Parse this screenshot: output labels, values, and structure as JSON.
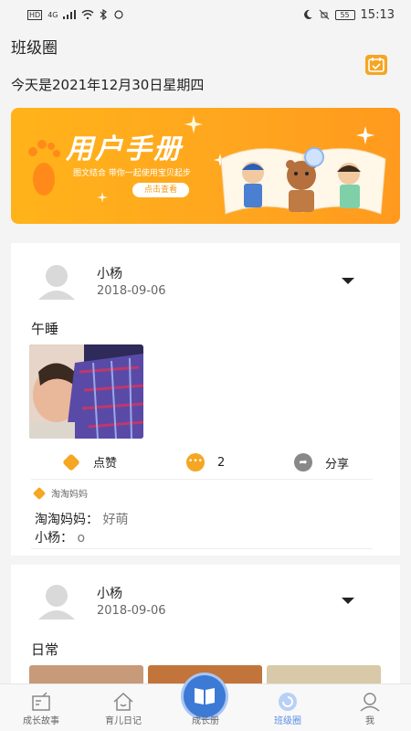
{
  "status_bar": {
    "left": [
      "HD",
      "4G",
      "signal",
      "wifi",
      "bluetooth",
      "huawei"
    ],
    "battery": "55",
    "time": "15:13"
  },
  "header": {
    "title": "班级圈",
    "date_line": "今天是2021年12月30日星期四"
  },
  "banner": {
    "title": "用户手册",
    "subtitle": "图文结合 带你一起使用宝贝起步",
    "button": "点击查看"
  },
  "posts": [
    {
      "user": "小杨",
      "date": "2018-09-06",
      "title": "午睡",
      "like_label": "点赞",
      "comment_count": "2",
      "share_label": "分享",
      "liked_by": "淘淘妈妈",
      "comments": [
        {
          "name": "淘淘妈妈：",
          "text": "好萌"
        },
        {
          "name": "小杨：",
          "text": "o"
        }
      ]
    },
    {
      "user": "小杨",
      "date": "2018-09-06",
      "title": "日常"
    }
  ],
  "tabs": [
    {
      "label": "成长故事",
      "icon": "story-icon"
    },
    {
      "label": "育儿日记",
      "icon": "house-icon"
    },
    {
      "label": "成长册",
      "icon": "book-icon"
    },
    {
      "label": "班级圈",
      "icon": "circle-icon",
      "active": true
    },
    {
      "label": "我",
      "icon": "profile-icon"
    }
  ],
  "colors": {
    "accent": "#f5a623",
    "tab_active": "#5b8ee6",
    "center_button": "#3d7ad6"
  }
}
